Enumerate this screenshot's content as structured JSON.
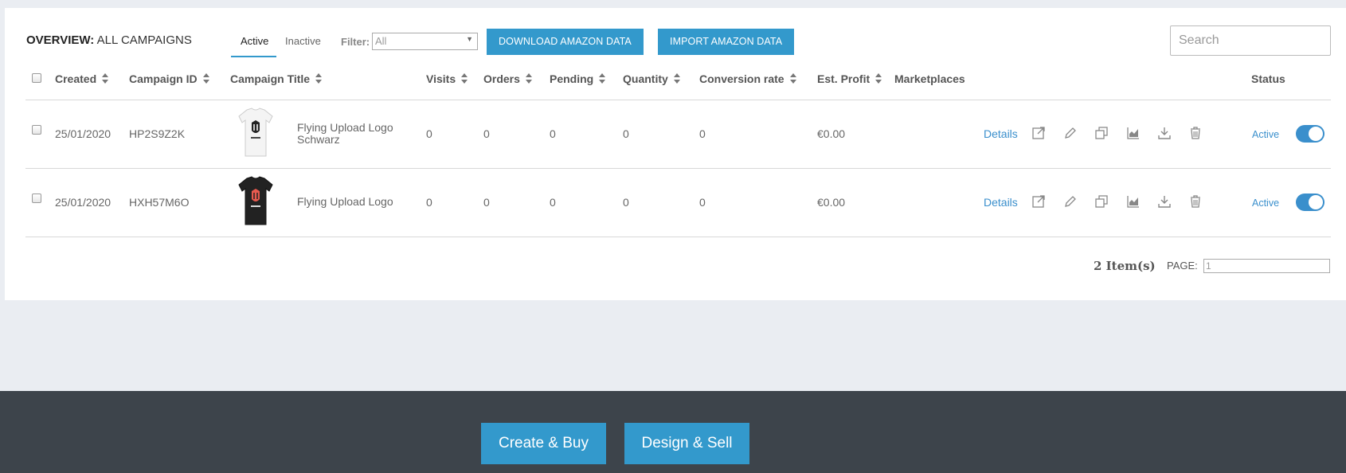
{
  "header": {
    "overview_label": "OVERVIEW:",
    "overview_value": "ALL CAMPAIGNS",
    "tabs": [
      {
        "label": "Active",
        "active": true
      },
      {
        "label": "Inactive",
        "active": false
      }
    ],
    "filter_label": "Filter:",
    "filter_value": "All",
    "download_button": "DOWNLOAD AMAZON DATA",
    "import_button": "IMPORT AMAZON DATA",
    "search_placeholder": "Search"
  },
  "table": {
    "columns": [
      "Created",
      "Campaign ID",
      "Campaign Title",
      "Visits",
      "Orders",
      "Pending",
      "Quantity",
      "Conversion rate",
      "Est. Profit",
      "Marketplaces",
      "Status"
    ],
    "rows": [
      {
        "created": "25/01/2020",
        "campaign_id": "HP2S9Z2K",
        "title_line1": "Flying Upload Logo",
        "title_line2": "Schwarz",
        "shirt_color": "#f4f4f4",
        "visits": "0",
        "orders": "0",
        "pending": "0",
        "quantity": "0",
        "conversion_rate": "0",
        "est_profit": "€0.00",
        "details_label": "Details",
        "status": "Active",
        "enabled": true
      },
      {
        "created": "25/01/2020",
        "campaign_id": "HXH57M6O",
        "title_line1": "Flying Upload Logo",
        "title_line2": "",
        "shirt_color": "#222222",
        "visits": "0",
        "orders": "0",
        "pending": "0",
        "quantity": "0",
        "conversion_rate": "0",
        "est_profit": "€0.00",
        "details_label": "Details",
        "status": "Active",
        "enabled": true
      }
    ],
    "action_icons": [
      "external-link-icon",
      "pencil-icon",
      "duplicate-icon",
      "chart-icon",
      "download-icon",
      "trash-icon"
    ]
  },
  "pagination": {
    "items_label": "2 Item(s)",
    "page_label": "PAGE:",
    "page_value": "1"
  },
  "footer": {
    "create_button": "Create & Buy",
    "design_button": "Design & Sell"
  },
  "colors": {
    "accent": "#3399cc",
    "footer_bg": "#3d444b",
    "page_bg": "#eaedf2"
  }
}
